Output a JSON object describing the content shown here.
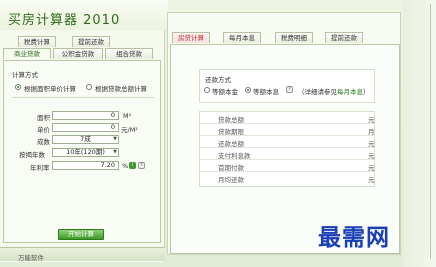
{
  "app": {
    "title": "买房计算器 2010"
  },
  "left": {
    "tabs_top": [
      "税费计算",
      "提前还款"
    ],
    "tabs_bottom": [
      "商业贷款",
      "公积金贷款",
      "组合贷款"
    ],
    "calc_method_label": "计算方式",
    "radio_by_price": "根据面积单价计算",
    "radio_by_total": "根据贷款总额计算",
    "area_label": "面积",
    "area_value": "0",
    "area_unit": "M²",
    "price_label": "单价",
    "price_value": "0",
    "price_unit": "元/M²",
    "down_label": "成数",
    "down_value": "7成",
    "years_label": "按揭年数",
    "years_value": "10年(120期)",
    "rate_label": "年利率",
    "rate_value": "7.20",
    "rate_unit": "%",
    "calc_button": "开始计算",
    "footer": "万能软件"
  },
  "right": {
    "tabs": [
      "房贷计算",
      "每月本息",
      "税费明细",
      "提前还款"
    ],
    "repay_label": "还款方式",
    "opt_equal_principal": "等额本金",
    "opt_equal_installment": "等额本息",
    "note_prefix": "（详细请参见",
    "note_link": "每月本息",
    "note_suffix": "）",
    "results": [
      {
        "name": "贷款总额",
        "unit": "元"
      },
      {
        "name": "贷款期限",
        "unit": "月"
      },
      {
        "name": "还款总额",
        "unit": "元"
      },
      {
        "name": "支付利息款",
        "unit": "元"
      },
      {
        "name": "首期付款",
        "unit": "元"
      },
      {
        "name": "月均还款",
        "unit": "元"
      }
    ]
  },
  "watermark": "最需网"
}
